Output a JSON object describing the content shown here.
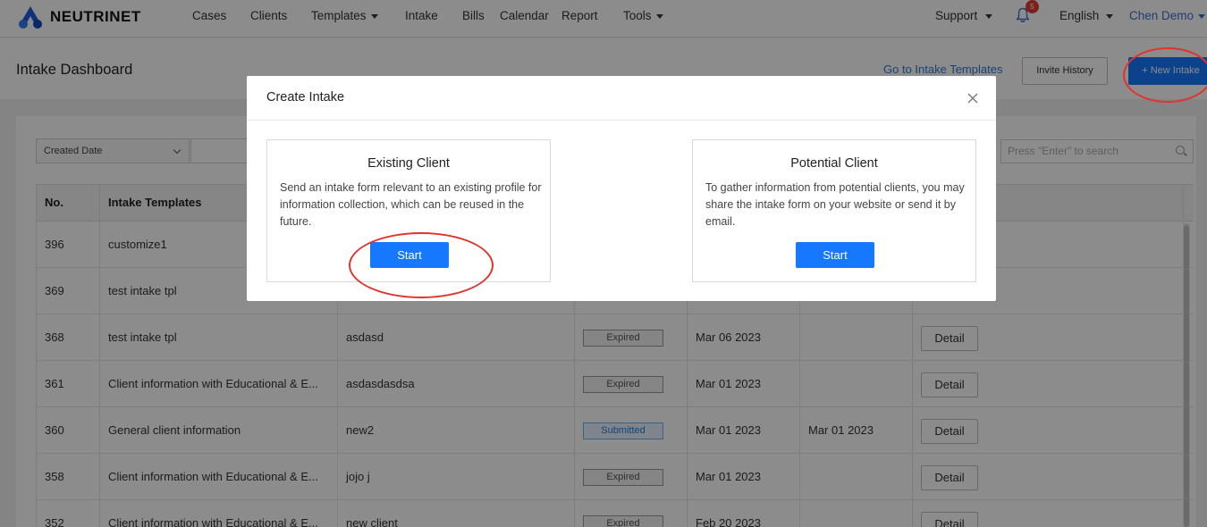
{
  "brand": {
    "name": "NEUTRINET"
  },
  "nav": {
    "items": [
      {
        "label": "Cases"
      },
      {
        "label": "Clients"
      },
      {
        "label": "Templates"
      },
      {
        "label": "Intake"
      },
      {
        "label": "Bills"
      },
      {
        "label": "Calendar"
      },
      {
        "label": "Report"
      },
      {
        "label": "Tools"
      }
    ],
    "support": "Support",
    "notifications_count": "5",
    "language": "English",
    "user": "Chen Demo"
  },
  "header": {
    "title": "Intake Dashboard",
    "templates_link": "Go to Intake Templates",
    "invite_history": "Invite History",
    "new_intake": "+ New Intake"
  },
  "filters": {
    "date_field": "Created Date",
    "search_placeholder": "Press \"Enter\" to search"
  },
  "table": {
    "columns": [
      "No.",
      "Intake Templates"
    ],
    "rows": [
      {
        "no": "396",
        "template": "customize1",
        "client": "",
        "status": "",
        "created": "",
        "submitted": "",
        "action": ""
      },
      {
        "no": "369",
        "template": "test intake tpl",
        "client": "",
        "status": "",
        "created": "",
        "submitted": "",
        "action": ""
      },
      {
        "no": "368",
        "template": "test intake tpl",
        "client": "asdasd",
        "status": "Expired",
        "created": "Mar 06 2023",
        "submitted": "",
        "action": "Detail"
      },
      {
        "no": "361",
        "template": "Client information with Educational & E...",
        "client": "asdasdasdsa",
        "status": "Expired",
        "created": "Mar 01 2023",
        "submitted": "",
        "action": "Detail"
      },
      {
        "no": "360",
        "template": "General client information",
        "client": "new2",
        "status": "Submitted",
        "created": "Mar 01 2023",
        "submitted": "Mar 01 2023",
        "action": "Detail"
      },
      {
        "no": "358",
        "template": "Client information with Educational & E...",
        "client": "jojo j",
        "status": "Expired",
        "created": "Mar 01 2023",
        "submitted": "",
        "action": "Detail"
      },
      {
        "no": "352",
        "template": "Client information with Educational & E...",
        "client": "new client",
        "status": "Expired",
        "created": "Feb 20 2023",
        "submitted": "",
        "action": "Detail"
      }
    ]
  },
  "modal": {
    "title": "Create Intake",
    "existing": {
      "title": "Existing Client",
      "description": "Send an intake form relevant to an existing profile for information collection, which can be reused in the future.",
      "button": "Start"
    },
    "potential": {
      "title": "Potential Client",
      "description": "To gather information from potential clients, you may share the intake form on your website or send it by email.",
      "button": "Start"
    }
  },
  "colors": {
    "primary": "#1677ff",
    "link": "#2f7ad4",
    "badge": "#e03c31",
    "annotation": "#e2332b"
  }
}
